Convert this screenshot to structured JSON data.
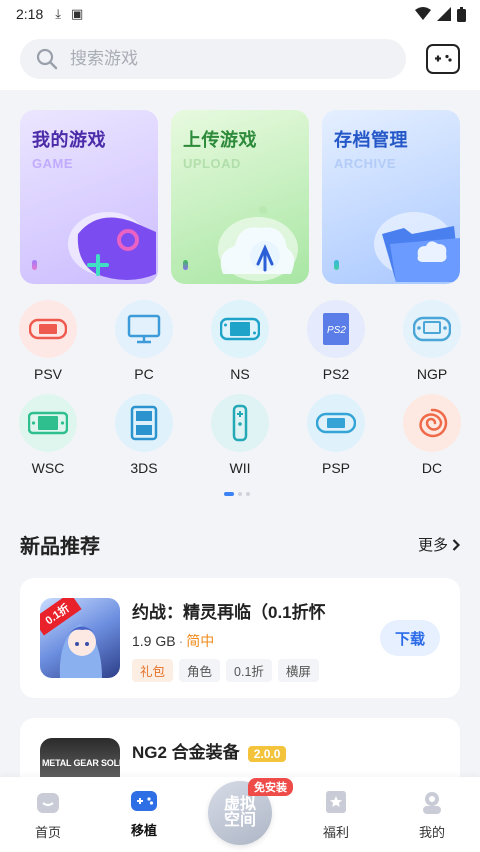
{
  "status_bar": {
    "time": "2:18"
  },
  "search": {
    "placeholder": "搜索游戏"
  },
  "feature_cards": [
    {
      "title": "我的游戏",
      "subtitle": "GAME"
    },
    {
      "title": "上传游戏",
      "subtitle": "UPLOAD"
    },
    {
      "title": "存档管理",
      "subtitle": "ARCHIVE"
    }
  ],
  "platforms": [
    "PSV",
    "PC",
    "NS",
    "PS2",
    "NGP",
    "WSC",
    "3DS",
    "WII",
    "PSP",
    "DC"
  ],
  "platform_icon_text": {
    "ps2": "PS2"
  },
  "section": {
    "title": "新品推荐",
    "more": "更多"
  },
  "games": [
    {
      "title": "约战：精灵再临（0.1折怀",
      "size": "1.9 GB",
      "language": "简中",
      "tags": [
        "礼包",
        "角色",
        "0.1折",
        "横屏"
      ],
      "action": "下载",
      "thumb_badge": "0.1折"
    },
    {
      "title": "NG2 合金装备",
      "version": "2.0.0",
      "thumb_text": "METAL GEAR SOLID"
    }
  ],
  "bottom_nav": {
    "items": [
      {
        "label": "首页"
      },
      {
        "label": "移植"
      },
      {
        "label": "福利"
      },
      {
        "label": "我的"
      }
    ],
    "center_label_1": "虚拟",
    "center_label_2": "空间",
    "center_badge": "免安装"
  },
  "colors": {
    "accent": "#2a6ae8",
    "active_nav": "#2f6fe6"
  }
}
